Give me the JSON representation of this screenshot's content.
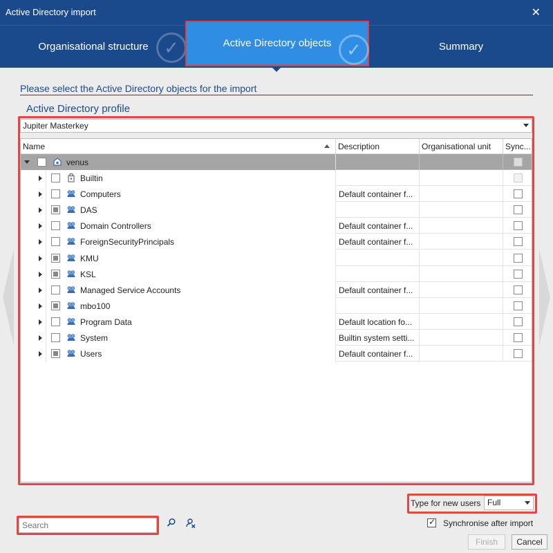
{
  "window": {
    "title": "Active Directory import",
    "close_glyph": "✕"
  },
  "wizard": {
    "steps": [
      {
        "label": "Organisational structure"
      },
      {
        "label": "Active Directory objects"
      },
      {
        "label": "Summary"
      }
    ],
    "check_glyph": "✓"
  },
  "instruction": "Please select the Active Directory objects for the import",
  "profile": {
    "title": "Active Directory profile",
    "selected": "Jupiter Masterkey"
  },
  "tree": {
    "columns": [
      "Name",
      "Description",
      "Organisational unit",
      "Sync..."
    ],
    "root": {
      "name": "venus",
      "description": "",
      "ou": ""
    },
    "items": [
      {
        "name": "Builtin",
        "description": "",
        "ou": "",
        "check": "empty",
        "icon": "builtin-icon",
        "sync": "disabled"
      },
      {
        "name": "Computers",
        "description": "Default container f...",
        "ou": "",
        "check": "empty",
        "icon": "ou-icon",
        "sync": "empty"
      },
      {
        "name": "DAS",
        "description": "",
        "ou": "",
        "check": "partial",
        "icon": "ou-icon",
        "sync": "empty"
      },
      {
        "name": "Domain Controllers",
        "description": "Default container f...",
        "ou": "",
        "check": "empty",
        "icon": "ou-icon",
        "sync": "empty"
      },
      {
        "name": "ForeignSecurityPrincipals",
        "description": "Default container f...",
        "ou": "",
        "check": "empty",
        "icon": "ou-icon",
        "sync": "empty"
      },
      {
        "name": "KMU",
        "description": "",
        "ou": "",
        "check": "partial",
        "icon": "ou-icon",
        "sync": "empty"
      },
      {
        "name": "KSL",
        "description": "",
        "ou": "",
        "check": "partial",
        "icon": "ou-icon",
        "sync": "empty"
      },
      {
        "name": "Managed Service Accounts",
        "description": "Default container f...",
        "ou": "",
        "check": "empty",
        "icon": "ou-icon",
        "sync": "empty"
      },
      {
        "name": "mbo100",
        "description": "",
        "ou": "",
        "check": "partial",
        "icon": "ou-icon",
        "sync": "empty"
      },
      {
        "name": "Program Data",
        "description": "Default location fo...",
        "ou": "",
        "check": "empty",
        "icon": "ou-icon",
        "sync": "empty"
      },
      {
        "name": "System",
        "description": "Builtin system setti...",
        "ou": "",
        "check": "empty",
        "icon": "ou-icon",
        "sync": "empty"
      },
      {
        "name": "Users",
        "description": "Default container f...",
        "ou": "",
        "check": "partial",
        "icon": "ou-icon",
        "sync": "empty"
      }
    ]
  },
  "type_for_new_users": {
    "label": "Type for new users",
    "value": "Full"
  },
  "search": {
    "placeholder": "Search"
  },
  "sync_after_import": {
    "label": "Synchronise after import",
    "checked": true,
    "check_glyph": "✓"
  },
  "buttons": {
    "finish": "Finish",
    "cancel": "Cancel"
  },
  "colors": {
    "header": "#1b4a8c",
    "active_step": "#2f8de4",
    "highlight_frame": "#e04848"
  }
}
